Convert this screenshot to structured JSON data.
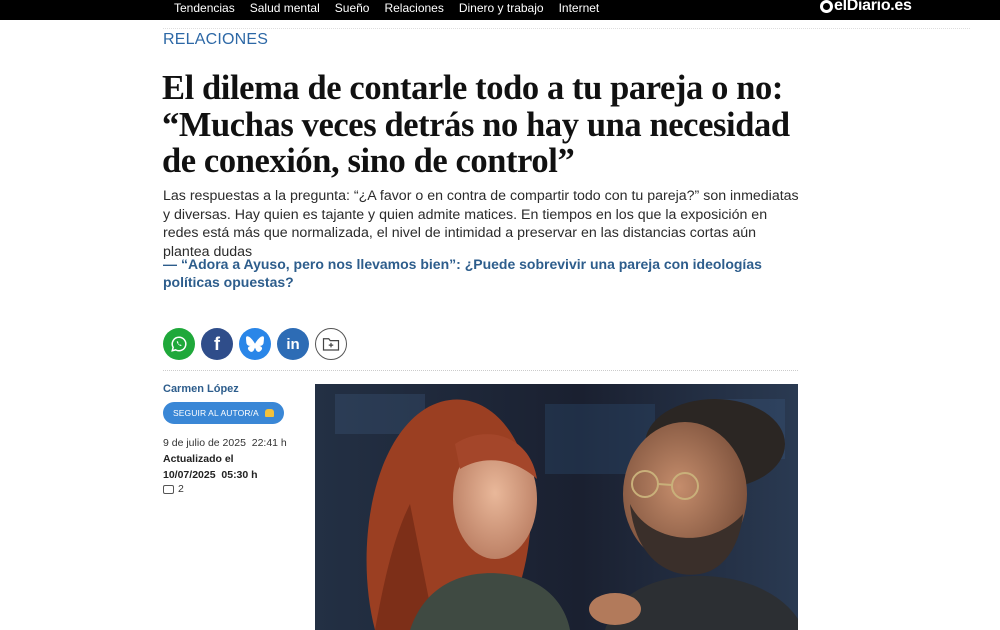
{
  "nav": {
    "items": [
      "Tendencias",
      "Salud mental",
      "Sueño",
      "Relaciones",
      "Dinero y trabajo",
      "Internet"
    ],
    "logo_text": "elDiario.es"
  },
  "article": {
    "section": "RELACIONES",
    "title": "El dilema de contarle todo a tu pareja o no: “Muchas veces detrás no hay una necesidad de conexión, sino de control”",
    "lead": "Las respuestas a la pregunta: “¿A favor o en contra de compartir todo con tu pareja?” son inmediatas y diversas. Hay quien es tajante y quien admite matices. En tiempos en los que la exposición en redes está más que normalizada, el nivel de intimidad a preservar en las distancias cortas aún plantea dudas",
    "related_dash": "—",
    "related": "“Adora a Ayuso, pero nos llevamos bien”: ¿Puede sobrevivir una pareja con ideologías políticas opuestas?"
  },
  "share": {
    "icons": [
      "whatsapp-icon",
      "facebook-icon",
      "bluesky-icon",
      "linkedin-icon",
      "save-folder-icon"
    ],
    "facebook_glyph": "f",
    "linkedin_glyph": "in"
  },
  "byline": {
    "author": "Carmen López",
    "follow_label": "SEGUIR AL AUTOR/A",
    "date": "9 de julio de 2025  22:41 h",
    "updated_label": "Actualizado el",
    "updated_date": "10/07/2025  05:30 h",
    "comments_count": "2"
  },
  "colors": {
    "section_blue": "#2d68a6",
    "whatsapp": "#1fa83a",
    "facebook": "#2f4d8a",
    "bluesky": "#2a86e8",
    "linkedin": "#2d6cb5",
    "follow_button": "#3a87d6"
  }
}
